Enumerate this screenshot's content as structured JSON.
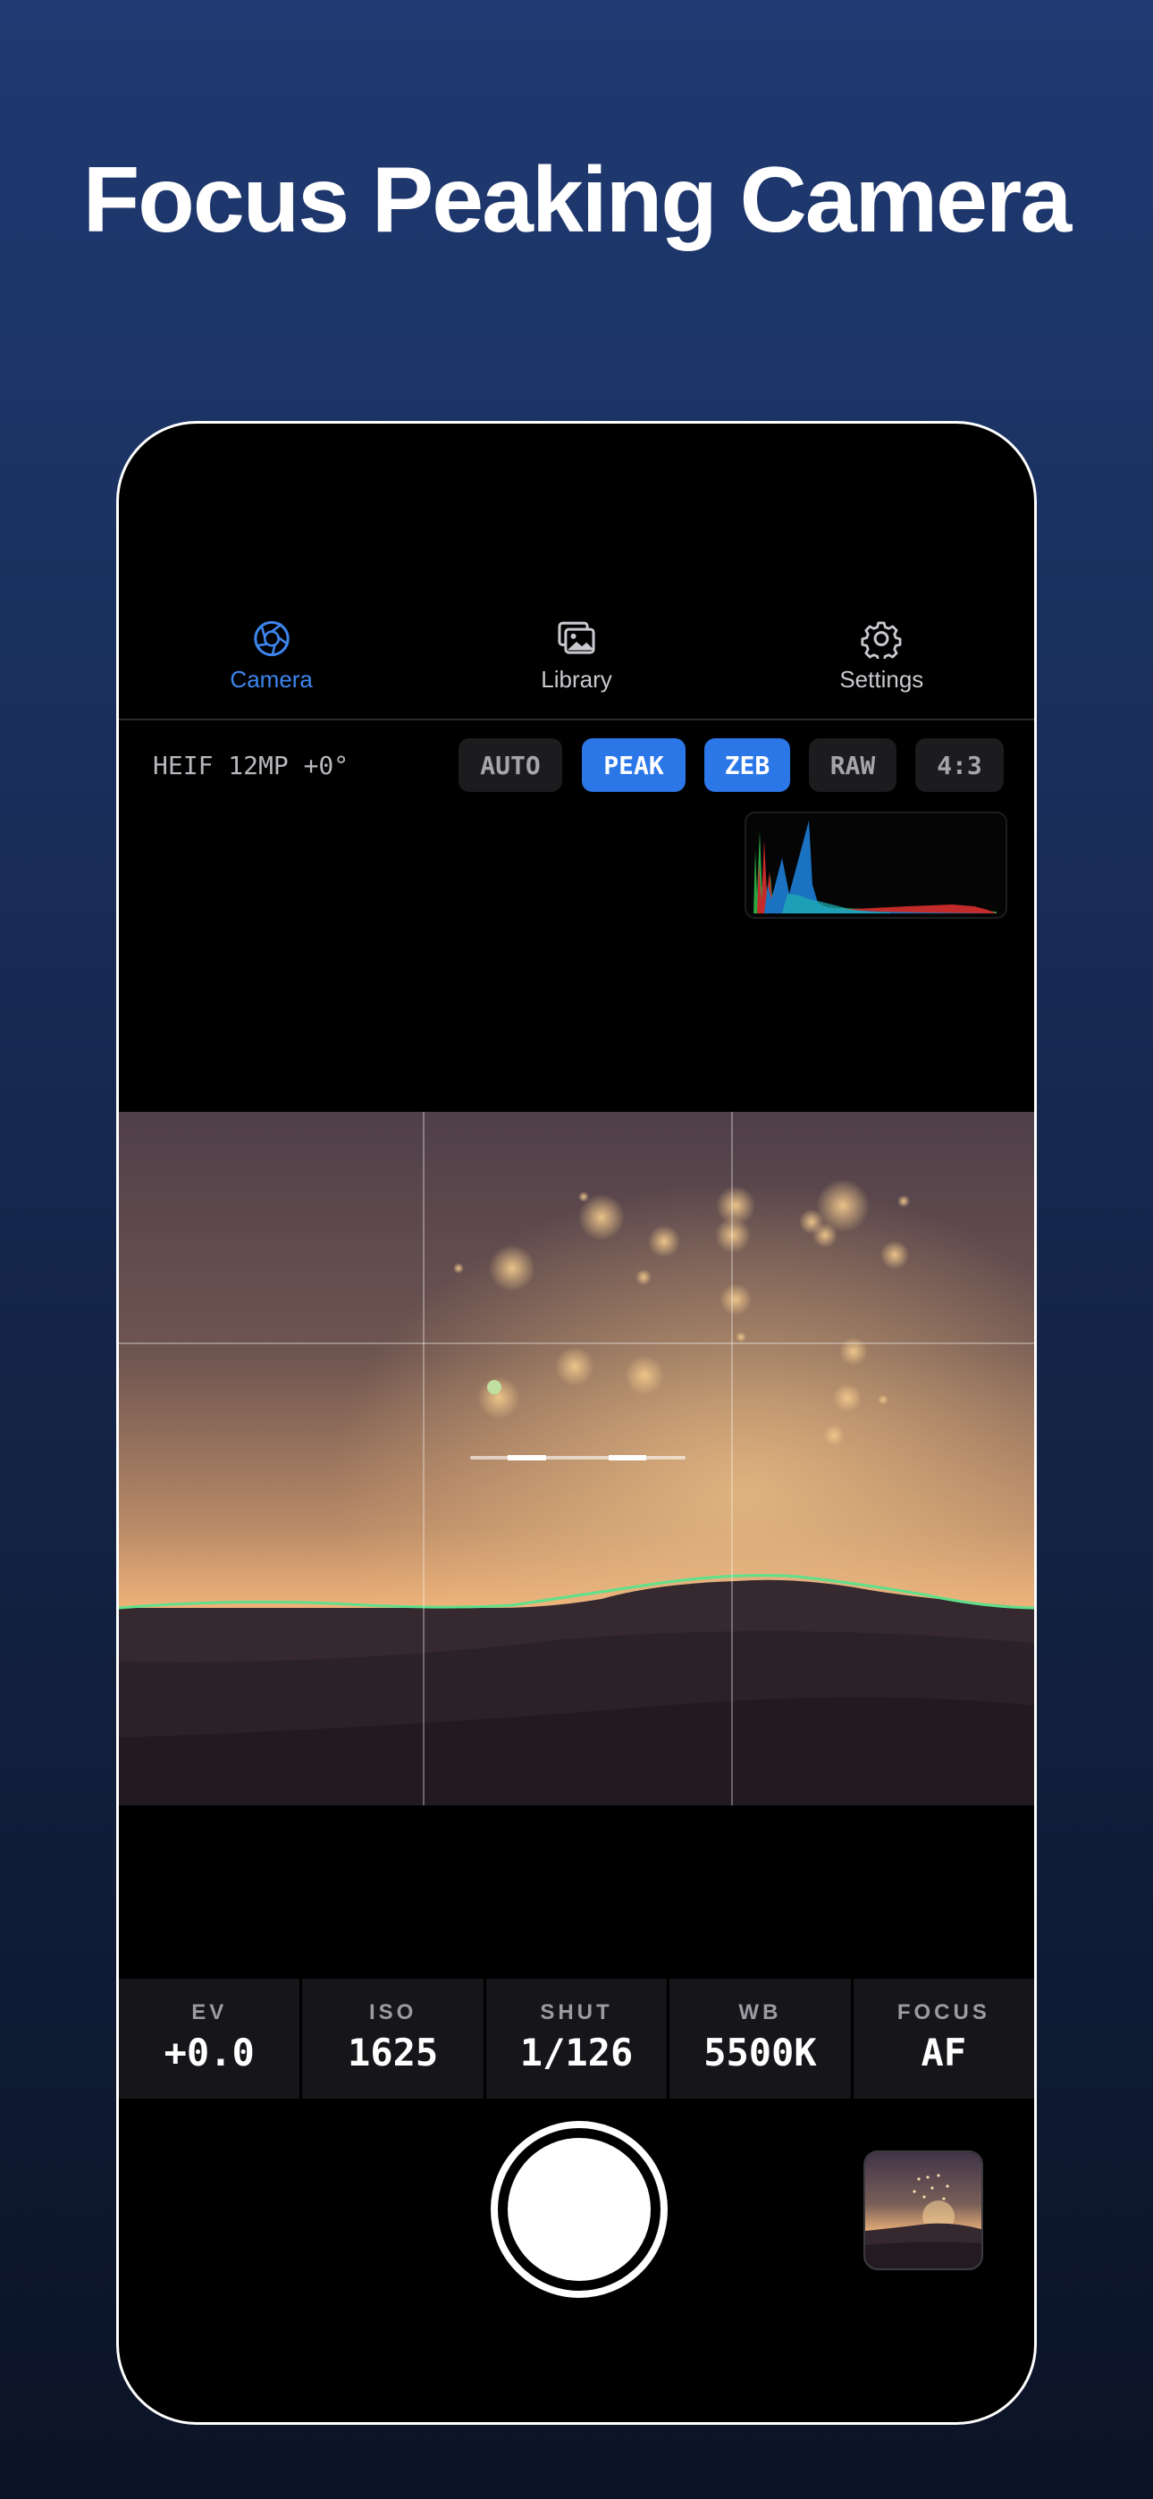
{
  "headline": "Focus Peaking Camera",
  "tabs": [
    {
      "label": "Camera",
      "icon": "aperture-icon",
      "active": true
    },
    {
      "label": "Library",
      "icon": "photo-stack-icon",
      "active": false
    },
    {
      "label": "Settings",
      "icon": "gear-icon",
      "active": false
    }
  ],
  "status": {
    "format_info": "HEIF 12MP +0°",
    "toggles": [
      {
        "label": "AUTO",
        "on": false
      },
      {
        "label": "PEAK",
        "on": true
      },
      {
        "label": "ZEB",
        "on": true
      },
      {
        "label": "RAW",
        "on": false
      },
      {
        "label": "4:3",
        "on": false
      }
    ]
  },
  "exposure": [
    {
      "label": "EV",
      "value": "+0.0"
    },
    {
      "label": "ISO",
      "value": "1625"
    },
    {
      "label": "SHUT",
      "value": "1/126"
    },
    {
      "label": "WB",
      "value": "5500K"
    },
    {
      "label": "FOCUS",
      "value": "AF"
    }
  ],
  "colors": {
    "accent": "#2c77e8",
    "active_tab": "#3d86ef",
    "peaking_edge": "#5fe08a"
  }
}
